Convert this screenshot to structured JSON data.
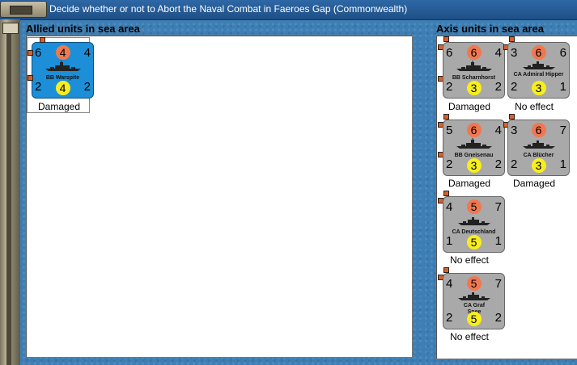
{
  "window": {
    "title": "Decide whether or not to Abort the Naval Combat in Faeroes Gap (Commonwealth)"
  },
  "allied": {
    "heading": "Allied units in sea area",
    "units": [
      {
        "name": "BB Warspite",
        "tl": "6",
        "tr": "4",
        "top": "4",
        "bl": "2",
        "bot": "4",
        "br": "2",
        "status": "Damaged",
        "color": "#1d8fd8"
      }
    ]
  },
  "axis": {
    "heading": "Axis units in sea area",
    "units": [
      {
        "name": "BB Scharnhorst",
        "tl": "6",
        "tr": "4",
        "top": "6",
        "bl": "2",
        "bot": "3",
        "br": "2",
        "status": "Damaged"
      },
      {
        "name": "CA Admiral Hipper",
        "tl": "3",
        "tr": "6",
        "top": "6",
        "bl": "2",
        "bot": "3",
        "br": "1",
        "status": "No effect"
      },
      {
        "name": "BB Gneisenau",
        "tl": "5",
        "tr": "4",
        "top": "6",
        "bl": "2",
        "bot": "3",
        "br": "2",
        "status": "Damaged"
      },
      {
        "name": "CA Blücher",
        "tl": "3",
        "tr": "7",
        "top": "6",
        "bl": "2",
        "bot": "3",
        "br": "1",
        "status": "Damaged"
      },
      {
        "name": "CA Deutschland",
        "tl": "4",
        "tr": "7",
        "top": "5",
        "bl": "1",
        "bot": "5",
        "br": "1",
        "status": "No effect"
      },
      {
        "name": "CA Graf Spee",
        "tl": "4",
        "tr": "7",
        "top": "5",
        "bl": "2",
        "bot": "5",
        "br": "2",
        "status": "No effect"
      }
    ]
  },
  "icons": {
    "unit": "warship-icon",
    "marker": "flag-marker-icon"
  },
  "colors": {
    "allied_counter": "#1d8fd8",
    "axis_counter": "#a9a9a9",
    "attack_circle": "#f07850",
    "defense_circle": "#f8ee1e"
  }
}
